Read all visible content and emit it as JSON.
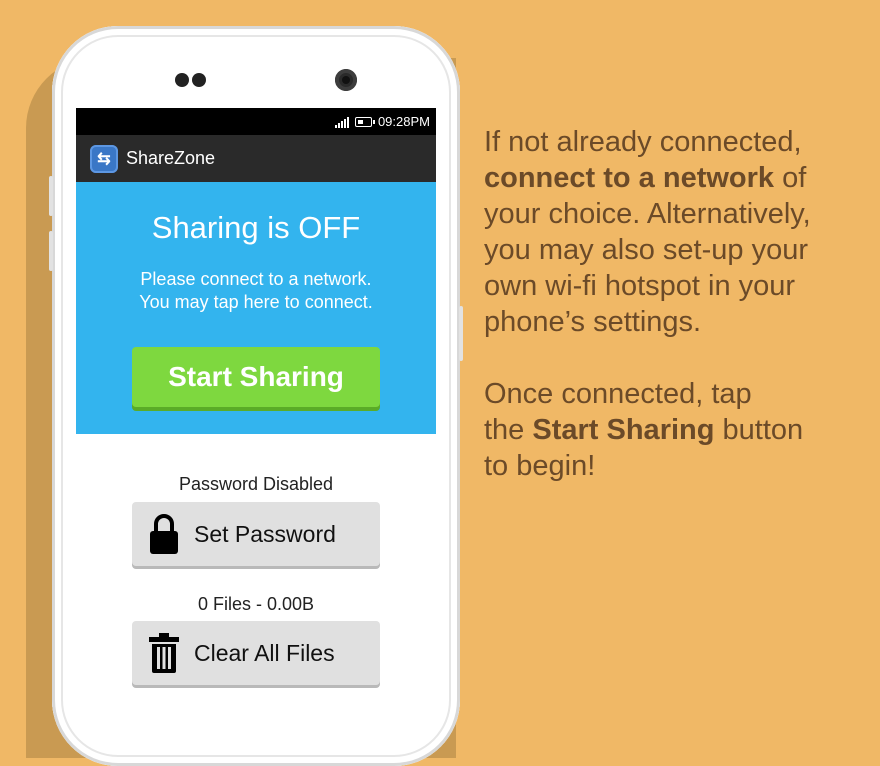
{
  "statusbar": {
    "time": "09:28PM"
  },
  "app": {
    "title": "ShareZone",
    "icon": "sharezone-app-icon"
  },
  "sharing_panel": {
    "status": "Sharing is OFF",
    "hint_line1": "Please connect to a network.",
    "hint_line2": "You may tap here to connect.",
    "start_label": "Start Sharing"
  },
  "password": {
    "status": "Password Disabled",
    "button_label": "Set Password",
    "icon": "lock-icon"
  },
  "files": {
    "status": "0 Files - 0.00B",
    "button_label": "Clear All Files",
    "icon": "trash-icon"
  },
  "copy": {
    "p1_part1": "If not already connected,",
    "p1_bold": "connect to a network",
    "p1_part2": " of",
    "p1_line3": "your choice. Alternatively,",
    "p1_line4": "you may also set-up your",
    "p1_line5": "own wi-fi hotspot in your",
    "p1_line6": "phone’s settings.",
    "p2_line1": "Once connected, tap",
    "p2_pre": "the ",
    "p2_bold": "Start Sharing",
    "p2_post": " button",
    "p2_line3": "to begin!"
  },
  "colors": {
    "background": "#f0b866",
    "panel_blue": "#33b4ee",
    "button_green": "#7ed83f",
    "copy_text": "#6b4a28"
  }
}
